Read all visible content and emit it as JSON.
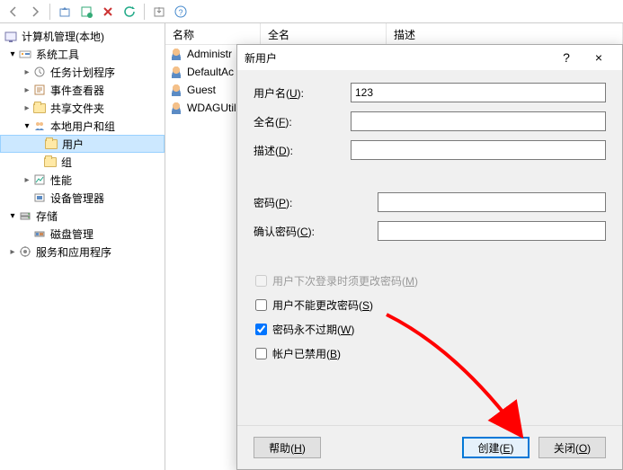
{
  "toolbar": {
    "icons": [
      "back",
      "forward",
      "up",
      "new-window",
      "remove",
      "refresh",
      "export",
      "help"
    ]
  },
  "tree": {
    "root": "计算机管理(本地)",
    "sys_tools": "系统工具",
    "task_sched": "任务计划程序",
    "event_viewer": "事件查看器",
    "shared_folders": "共享文件夹",
    "local_users": "本地用户和组",
    "users": "用户",
    "groups": "组",
    "performance": "性能",
    "device_mgr": "设备管理器",
    "storage": "存储",
    "disk_mgmt": "磁盘管理",
    "services_apps": "服务和应用程序"
  },
  "list": {
    "col_name": "名称",
    "col_fullname": "全名",
    "col_desc": "描述",
    "rows": [
      {
        "name": "Administr"
      },
      {
        "name": "DefaultAc"
      },
      {
        "name": "Guest"
      },
      {
        "name": "WDAGUtil"
      }
    ]
  },
  "dialog": {
    "title": "新用户",
    "help": "?",
    "close": "×",
    "username_label": "用户名(U):",
    "username_value": "123",
    "fullname_label": "全名(F):",
    "fullname_value": "",
    "desc_label": "描述(D):",
    "desc_value": "",
    "password_label": "密码(P):",
    "password_value": "",
    "confirm_label": "确认密码(C):",
    "confirm_value": "",
    "must_change_label": "用户下次登录时须更改密码(M)",
    "cannot_change_label": "用户不能更改密码(S)",
    "never_expires_label": "密码永不过期(W)",
    "disabled_label": "帐户已禁用(B)",
    "help_btn": "帮助(H)",
    "create_btn": "创建(E)",
    "close_btn": "关闭(O)"
  }
}
